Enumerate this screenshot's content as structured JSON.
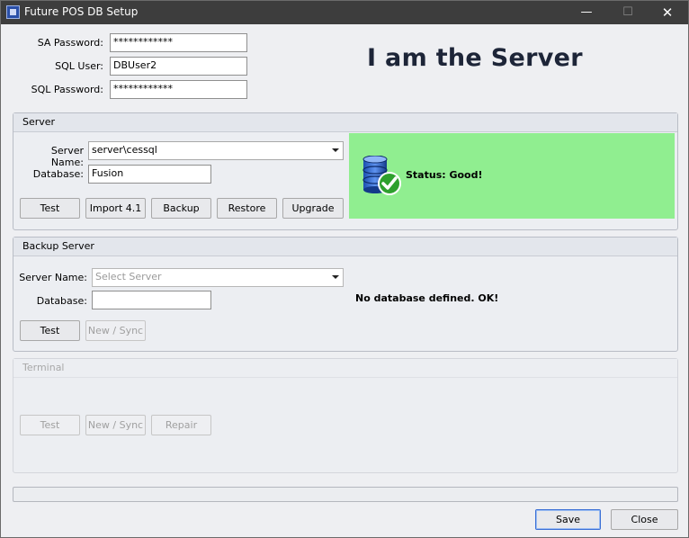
{
  "window": {
    "title": "Future POS DB Setup",
    "controls": {
      "minimize": "—",
      "maximize": "☐",
      "close": "✕"
    }
  },
  "credentials": {
    "sa_password_label": "SA Password:",
    "sa_password_value": "************",
    "sql_user_label": "SQL User:",
    "sql_user_value": "DBUser2",
    "sql_password_label": "SQL Password:",
    "sql_password_value": "************"
  },
  "headline": "I am the Server",
  "server": {
    "header": "Server",
    "server_name_label": "Server Name:",
    "server_name_value": "server\\cessql",
    "database_label": "Database:",
    "database_value": "Fusion",
    "buttons": {
      "test": "Test",
      "import": "Import 4.1",
      "backup": "Backup",
      "restore": "Restore",
      "upgrade": "Upgrade"
    },
    "status_text": "Status: Good!",
    "status_color": "#90ee90"
  },
  "backup_server": {
    "header": "Backup Server",
    "server_name_label": "Server Name:",
    "server_name_placeholder": "Select Server",
    "database_label": "Database:",
    "database_value": "",
    "message": "No database defined. OK!",
    "buttons": {
      "test": "Test",
      "new_sync": "New / Sync"
    }
  },
  "terminal": {
    "header": "Terminal",
    "buttons": {
      "test": "Test",
      "new_sync": "New / Sync",
      "repair": "Repair"
    }
  },
  "footer": {
    "save": "Save",
    "close": "Close"
  }
}
